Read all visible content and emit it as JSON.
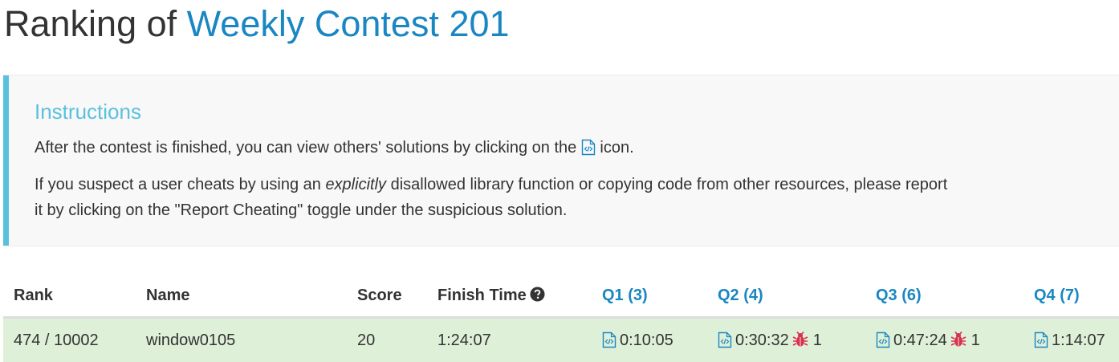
{
  "title": {
    "prefix": "Ranking of ",
    "contest_name": "Weekly Contest 201"
  },
  "instructions": {
    "heading": "Instructions",
    "p1_before": "After the contest is finished, you can view others' solutions by clicking on the ",
    "p1_after": " icon.",
    "p2_before": "If you suspect a user cheats by using an ",
    "p2_emphasis": "explicitly",
    "p2_after": " disallowed library function or copying code from other resources, please report it by clicking on the \"Report Cheating\" toggle under the suspicious solution."
  },
  "table": {
    "headers": {
      "rank": "Rank",
      "name": "Name",
      "score": "Score",
      "finish_time": "Finish Time",
      "q1": "Q1 (3)",
      "q2": "Q2 (4)",
      "q3": "Q3 (6)",
      "q4": "Q4 (7)"
    },
    "rows": [
      {
        "rank": "474 / 10002",
        "name": "window0105",
        "score": "20",
        "finish_time": "1:24:07",
        "q1": {
          "time": "0:10:05"
        },
        "q2": {
          "time": "0:30:32",
          "bugs": "1"
        },
        "q3": {
          "time": "0:47:24",
          "bugs": "1"
        },
        "q4": {
          "time": "1:14:07"
        }
      }
    ]
  },
  "colors": {
    "link": "#1a86c2",
    "info_accent": "#5bc0de",
    "row_highlight": "#dff0d8",
    "bug": "#d9304f"
  },
  "icons": {
    "code": "code-file-icon",
    "help": "question-circle-icon",
    "bug": "bug-icon"
  }
}
